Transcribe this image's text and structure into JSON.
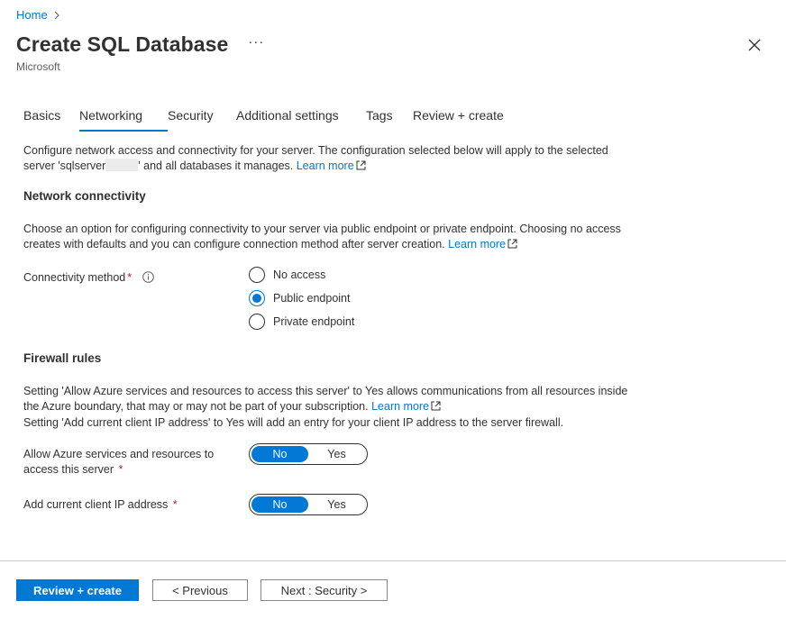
{
  "breadcrumb": {
    "home": "Home"
  },
  "header": {
    "title": "Create SQL Database",
    "more": "···",
    "publisher": "Microsoft"
  },
  "tabs": [
    {
      "label": "Basics"
    },
    {
      "label": "Networking"
    },
    {
      "label": "Security"
    },
    {
      "label": "Additional settings"
    },
    {
      "label": "Tags"
    },
    {
      "label": "Review + create"
    }
  ],
  "intro": {
    "line1": "Configure network access and connectivity for your server. The configuration selected below will apply to the selected",
    "line2_prefix": "server 'sqlserver",
    "line2_suffix": "' and all databases it manages.",
    "learn_more": "Learn more"
  },
  "network_connectivity": {
    "title": "Network connectivity",
    "desc_line1": "Choose an option for configuring connectivity to your server via public endpoint or private endpoint. Choosing no access",
    "desc_line2": "creates with defaults and you can configure connection method after server creation.",
    "learn_more": "Learn more",
    "method_label": "Connectivity method",
    "required_mark": "*",
    "options": [
      {
        "label": "No access",
        "selected": false
      },
      {
        "label": "Public endpoint",
        "selected": true
      },
      {
        "label": "Private endpoint",
        "selected": false
      }
    ]
  },
  "firewall": {
    "title": "Firewall rules",
    "desc_line1": "Setting 'Allow Azure services and resources to access this server' to Yes allows communications from all resources inside",
    "desc_line2": "the Azure boundary, that may or may not be part of your subscription.",
    "learn_more": "Learn more",
    "desc_line3": "Setting 'Add current client IP address' to Yes will add an entry for your client IP address to the server firewall.",
    "allow_azure_label_1": "Allow Azure services and resources to",
    "allow_azure_label_2": "access this server",
    "client_ip_label": "Add current client IP address",
    "required_mark": "*",
    "toggle_no": "No",
    "toggle_yes": "Yes",
    "allow_azure_value": "No",
    "client_ip_value": "No"
  },
  "footer": {
    "review_create": "Review + create",
    "previous": "< Previous",
    "next": "Next : Security >"
  },
  "colors": {
    "accent": "#0078d4",
    "required": "#a4262c",
    "text": "#323130"
  }
}
